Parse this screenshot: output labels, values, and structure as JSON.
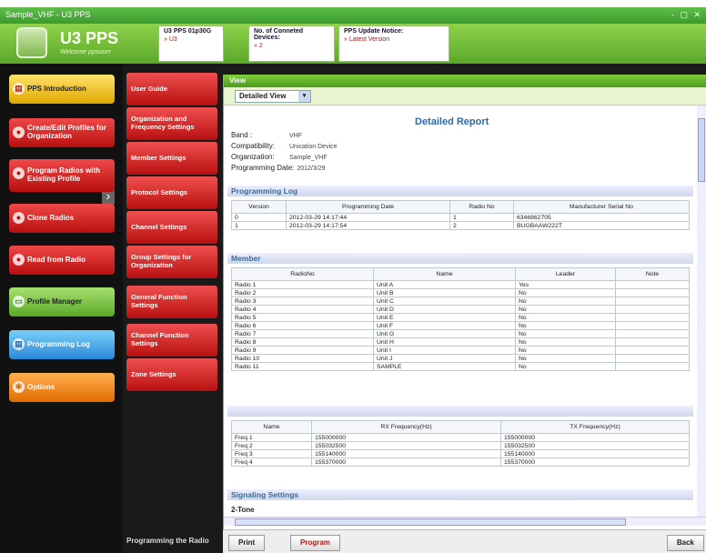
{
  "window": {
    "title": "Sample_VHF - U3 PPS",
    "controls": "- ▢ ✕"
  },
  "header": {
    "app_name": "U3 PPS",
    "welcome": "Welcome ppsuser",
    "box1": {
      "title": "U3 PPS 01p30G",
      "value": "» U3"
    },
    "box2": {
      "title": "No. of Conneted Devices:",
      "value": "» 2"
    },
    "box3": {
      "title": "PPS Update Notice:",
      "value": "» Latest Version"
    }
  },
  "left_nav": [
    {
      "label": "PPS Introduction",
      "style": "yellow",
      "icon": "document-icon"
    },
    {
      "label": "Create/Edit Profiles for Organization",
      "style": "red",
      "icon": "radio-icon"
    },
    {
      "label": "Program Radios with Existing Profile",
      "style": "red",
      "icon": "radio-icon"
    },
    {
      "label": "Clone Radios",
      "style": "red",
      "icon": "radio-icon"
    },
    {
      "label": "Read from Radio",
      "style": "red",
      "icon": "radio-icon"
    },
    {
      "label": "Profile Manager",
      "style": "green",
      "icon": "folder-icon"
    },
    {
      "label": "Programming Log",
      "style": "blue",
      "icon": "log-icon"
    },
    {
      "label": "Options",
      "style": "orange",
      "icon": "gear-icon"
    }
  ],
  "sub_nav": [
    "User Guide",
    "Organization and Frequency Settings",
    "Member Settings",
    "Protocol Settings",
    "Channel Settings",
    "Group Settings for Organization",
    "General Function Settings",
    "Channel Function Settings",
    "Zone Settings"
  ],
  "sub_footer": "Programming the Radio",
  "view": {
    "header": "View",
    "selected": "Detailed View",
    "dropdown_arrow": "▾"
  },
  "report": {
    "title": "Detailed Report",
    "band_label": "Band :",
    "band": "VHF",
    "compat_label": "Compatibility:",
    "compat": "Unication Device",
    "org_label": "Organization:",
    "org": "Sample_VHF",
    "date_label": "Programming Date:",
    "date": "2012/3/29",
    "log_section": "Programming Log",
    "log_headers": [
      "Version",
      "Programming Date",
      "Radio No",
      "Manufacturer Serial No"
    ],
    "log_rows": [
      [
        "0",
        "2012-03-29 14:17:44",
        "1",
        "6346862705"
      ],
      [
        "1",
        "2012-03-29 14:17:54",
        "2",
        "BUGBAAW222T"
      ]
    ],
    "member_section": "Member",
    "member_headers": [
      "RadioNo",
      "Name",
      "Leader",
      "Note"
    ],
    "member_rows": [
      [
        "Radio 1",
        "Unit A",
        "Yes",
        ""
      ],
      [
        "Radio 2",
        "Unit B",
        "No",
        ""
      ],
      [
        "Radio 3",
        "Unit C",
        "No",
        ""
      ],
      [
        "Radio 4",
        "Unit D",
        "No",
        ""
      ],
      [
        "Radio 5",
        "Unit E",
        "No",
        ""
      ],
      [
        "Radio 6",
        "Unit F",
        "No",
        ""
      ],
      [
        "Radio 7",
        "Unit G",
        "No",
        ""
      ],
      [
        "Radio 8",
        "Unit H",
        "No",
        ""
      ],
      [
        "Radio 9",
        "Unit I",
        "No",
        ""
      ],
      [
        "Radio 10",
        "Unit J",
        "No",
        ""
      ],
      [
        "Radio 11",
        "SAMPLE",
        "No",
        ""
      ]
    ],
    "freq_headers": [
      "Name",
      "RX Frequency(Hz)",
      "TX Frequency(Hz)"
    ],
    "freq_rows": [
      [
        "Freq 1",
        "155000000",
        "155000000"
      ],
      [
        "Freq 2",
        "155032500",
        "155032500"
      ],
      [
        "Freq 3",
        "155140000",
        "155140000"
      ],
      [
        "Freq 4",
        "155370000",
        "155370000"
      ]
    ],
    "signaling_section": "Signaling Settings",
    "signaling_sub": "2-Tone"
  },
  "bottom": {
    "print": "Print",
    "program": "Program",
    "back": "Back"
  },
  "colors": {
    "brand_green": "#5aa82a",
    "nav_red": "#b80e0e",
    "report_blue": "#2a6ab0"
  }
}
